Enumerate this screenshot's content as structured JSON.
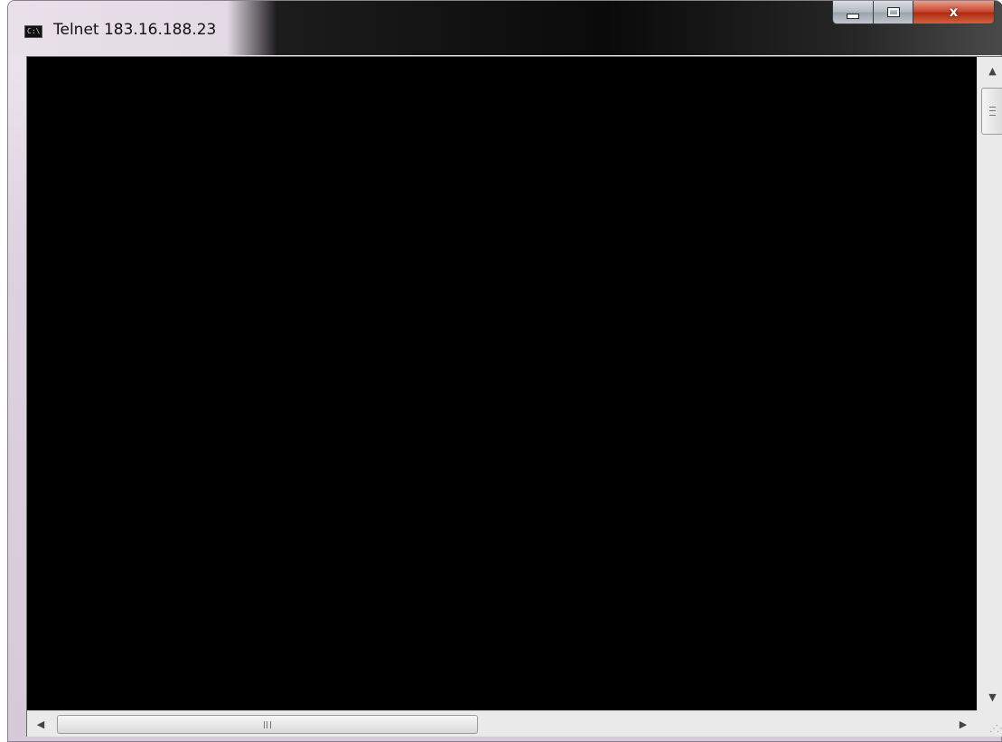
{
  "window": {
    "title": "Telnet 183.16.188.23",
    "icon": "console-icon",
    "icon_text": "C:\\"
  },
  "caption_buttons": {
    "minimize_icon": "minimize-icon",
    "maximize_icon": "maximize-icon",
    "close_icon": "close-icon",
    "close_glyph": "x"
  },
  "console": {
    "text": ""
  },
  "vertical_scrollbar": {
    "up_arrow": "▲",
    "down_arrow": "▼"
  },
  "horizontal_scrollbar": {
    "left_arrow": "◀",
    "right_arrow": "▶"
  },
  "colors": {
    "console_background": "#000000",
    "close_button": "#c7452b",
    "scrollbar_track": "#eaeaea"
  }
}
